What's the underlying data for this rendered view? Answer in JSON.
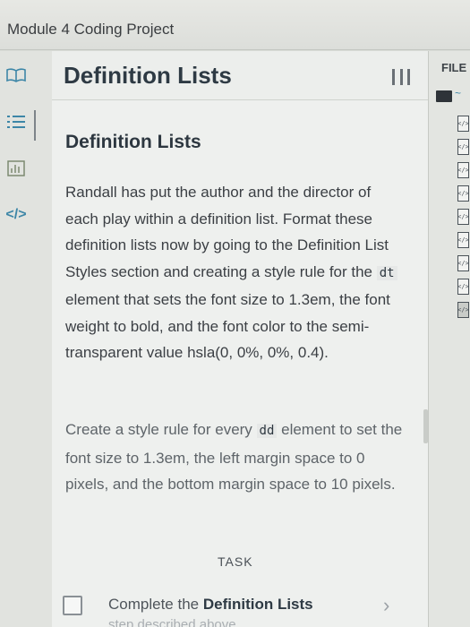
{
  "window": {
    "title": "Module 4 Coding Project"
  },
  "rail": {
    "icons": [
      "book-icon",
      "list-icon",
      "chart-icon",
      "code-icon"
    ],
    "code_label": "</>"
  },
  "header": {
    "title": "Definition Lists",
    "menu_icon": "columns-menu-icon"
  },
  "content": {
    "heading": "Definition Lists",
    "p1": {
      "a": "Randall has put the author and the director of each play within a definition list. Format these definition lists now by going to the Definition List Styles section and creating a style rule for the ",
      "code": "dt",
      "b": " element that sets the font size to 1.3em, the font weight to bold, and the font color to the semi-transparent value hsla(0, 0%, 0%, 0.4)."
    },
    "p2": {
      "a": "Create a style rule for every ",
      "code": "dd",
      "b": " element to set the font size to 1.3em, the left margin space to 0 pixels, and the bottom margin space to 10 pixels."
    }
  },
  "task": {
    "label": "TASK",
    "text_prefix": "Complete the ",
    "text_bold": "Definition Lists",
    "subtext": "step described above"
  },
  "files": {
    "label": "FILE",
    "folder_tilde": "~",
    "file_glyph": "</>",
    "count": 9
  }
}
